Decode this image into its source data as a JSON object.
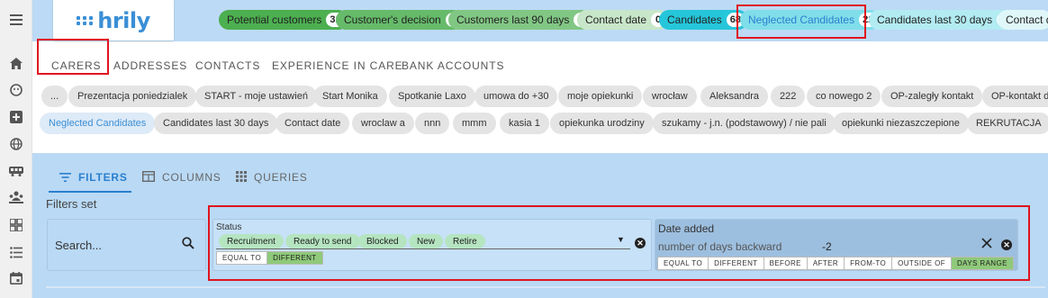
{
  "app": {
    "logo_text": "hrily"
  },
  "rail_icons": [
    "menu-icon",
    "home-icon",
    "face-icon",
    "hospital-icon",
    "globe-icon",
    "bus-icon",
    "people-icon",
    "dashboard-icon",
    "list-icon",
    "calendar-icon"
  ],
  "top_pills": [
    {
      "label": "Potential customers",
      "count": "31",
      "color": "#4caf50"
    },
    {
      "label": "Customer's decision",
      "count": "0",
      "color": "#66bb6a"
    },
    {
      "label": "Customers last 90 days",
      "count": "6",
      "color": "#81c784"
    },
    {
      "label": "Contact date",
      "count": "0",
      "color": "#c8e6c9"
    },
    {
      "label": "Candidates",
      "count": "68",
      "color": "#26c6da"
    },
    {
      "label": "Neglected Candidates",
      "count": "22",
      "color": "#80deea"
    },
    {
      "label": "Candidates last 30 days",
      "count": "32",
      "color": "#b2ebf2"
    },
    {
      "label": "Contact d",
      "count": "",
      "color": "#e0f7fa"
    }
  ],
  "tabs": [
    "CARERS",
    "ADDRESSES",
    "CONTACTS",
    "EXPERIENCE IN CARE",
    "BANK ACCOUNTS"
  ],
  "saved_filters_row1": [
    "...",
    "Prezentacja poniedzialek",
    "START - moje ustawień",
    "Start Monika",
    "Spotkanie Laxo",
    "umowa do +30",
    "moje opiekunki",
    "wrocław",
    "Aleksandra",
    "222",
    "co nowego 2",
    "OP-zaległy kontakt",
    "OP-kontakt dz"
  ],
  "saved_filters_row2": [
    "Neglected Candidates",
    "Candidates last 30 days",
    "Contact date",
    "wroclaw a",
    "nnn",
    "mmm",
    "kasia 1",
    "opiekunka urodziny",
    "szukamy - j.n. (podstawowy) / nie pali",
    "opiekunki niezaszczepione",
    "REKRUTACJA"
  ],
  "filter_tabs": [
    "FILTERS",
    "COLUMNS",
    "QUERIES"
  ],
  "filters_set_label": "Filters set",
  "search": {
    "placeholder": "Search..."
  },
  "status_filter": {
    "label": "Status",
    "tags": [
      "Recruitment",
      "Ready to send",
      "Blocked",
      "New",
      "Retire"
    ],
    "modes": [
      "EQUAL TO",
      "DIFFERENT"
    ],
    "active_mode": "DIFFERENT"
  },
  "date_filter": {
    "label": "Date added",
    "placeholder": "number of days backward",
    "value": "-2",
    "modes": [
      "EQUAL TO",
      "DIFFERENT",
      "BEFORE",
      "AFTER",
      "FROM-TO",
      "OUTSIDE OF",
      "DAYS RANGE"
    ],
    "active_mode": "DAYS RANGE"
  }
}
